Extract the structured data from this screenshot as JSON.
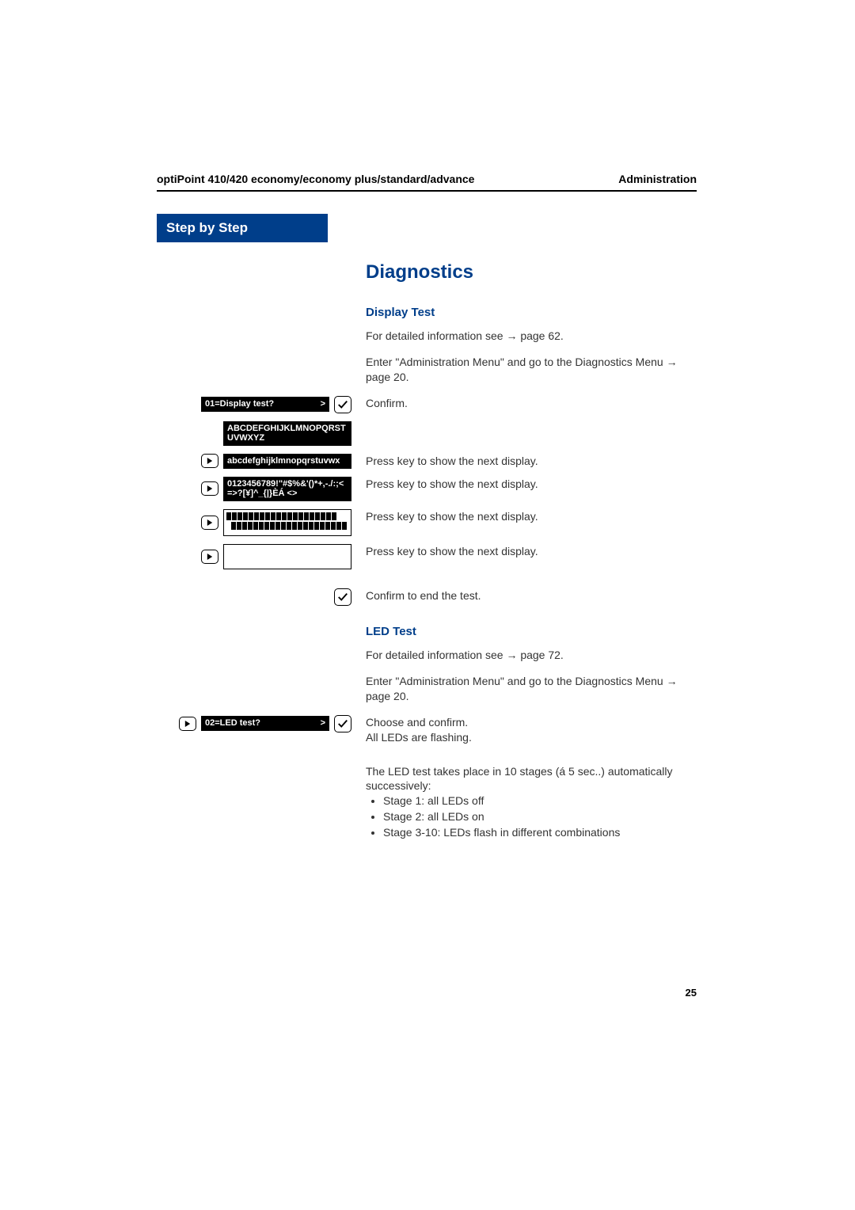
{
  "header": {
    "left": "optiPoint 410/420 economy/economy plus/standard/advance",
    "right": "Administration"
  },
  "stepbar": "Step by Step",
  "section_title": "Diagnostics",
  "display_test": {
    "heading": "Display Test",
    "p1a": "For detailed information see ",
    "p1b": " page 62.",
    "p2a": "Enter \"Administration Menu\" and go to the Diagnostics Menu ",
    "p2b": " page 20.",
    "rows": [
      {
        "display": "01=Display test?",
        "gt": ">",
        "inverted": true,
        "play": false,
        "check": true,
        "text": "Confirm."
      },
      {
        "display": "ABCDEFGHIJKLMNOPQRSTUVWXYZ",
        "inverted": true,
        "play": false,
        "check": false,
        "text": ""
      },
      {
        "display": "abcdefghijklmnopqrstuvwx",
        "inverted": true,
        "play": true,
        "check": false,
        "text": "Press key to show the next display."
      },
      {
        "display": "0123456789!\"#$%&'()*+,-./:;<=>?[¥]^_{|}ÈÁ <>",
        "inverted": true,
        "play": true,
        "check": false,
        "text": "Press key to show the next display."
      },
      {
        "blocks": true,
        "play": true,
        "check": false,
        "text": "Press key to show the next display."
      },
      {
        "empty": true,
        "play": true,
        "check": false,
        "text": "Press key to show the next display."
      },
      {
        "nodisplay": true,
        "play": false,
        "check": true,
        "text": "Confirm to end the test."
      }
    ]
  },
  "led_test": {
    "heading": "LED Test",
    "p1a": "For detailed information see ",
    "p1b": " page 72.",
    "p2a": "Enter \"Administration Menu\" and go to the Diagnostics Menu ",
    "p2b": " page 20.",
    "row": {
      "display": "02=LED test?",
      "gt": ">",
      "text1": "Choose and confirm.",
      "text2": "All LEDs are flashing."
    },
    "desc": "The LED test takes place in 10 stages (á 5 sec..) automatically successively:",
    "stages": [
      "Stage 1: all LEDs off",
      "Stage 2: all LEDs on",
      "Stage 3-10: LEDs flash in different combinations"
    ]
  },
  "arrow_glyph": "→",
  "page_num": "25"
}
